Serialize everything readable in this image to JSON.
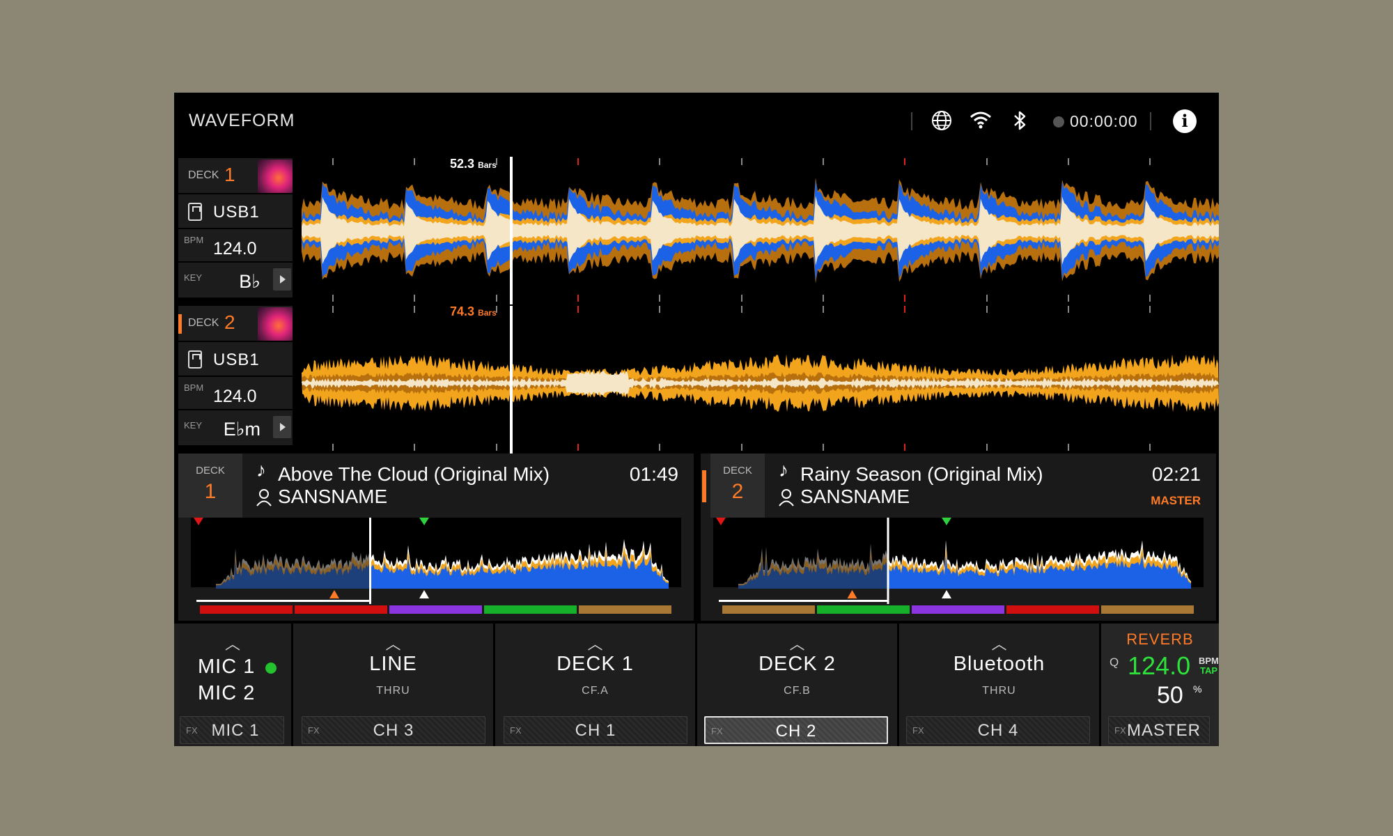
{
  "header": {
    "title": "WAVEFORM",
    "time": "00:00:00",
    "icons": [
      "globe-icon",
      "wifi-icon",
      "bluetooth-icon",
      "rec-indicator-icon",
      "info-icon"
    ]
  },
  "decks": [
    {
      "deck_label": "DECK",
      "deck_num": "1",
      "source": "USB1",
      "bpm_label": "BPM",
      "bpm": "124.0",
      "key_label": "KEY",
      "key": "B♭",
      "bars": "52.3",
      "bars_unit": "Bars"
    },
    {
      "deck_label": "DECK",
      "deck_num": "2",
      "source": "USB1",
      "bpm_label": "BPM",
      "bpm": "124.0",
      "key_label": "KEY",
      "key": "E♭m",
      "bars": "74.3",
      "bars_unit": "Bars"
    }
  ],
  "tracks": [
    {
      "deck_label": "DECK",
      "deck_num": "1",
      "title": "Above The Cloud (Original Mix)",
      "artist": "SANSNAME",
      "time": "01:49",
      "status": ""
    },
    {
      "deck_label": "DECK",
      "deck_num": "2",
      "title": "Rainy Season (Original Mix)",
      "artist": "SANSNAME",
      "time": "02:21",
      "status": "MASTER"
    }
  ],
  "mixer": {
    "mic": {
      "mic1": "MIC 1",
      "mic2": "MIC 2",
      "fx_label": "FX",
      "fx_target": "MIC 1"
    },
    "channels": [
      {
        "name": "LINE",
        "sub": "THRU",
        "fx_label": "FX",
        "fx_target": "CH 3",
        "active": false
      },
      {
        "name": "DECK 1",
        "sub": "CF.A",
        "fx_label": "FX",
        "fx_target": "CH 1",
        "active": false
      },
      {
        "name": "DECK 2",
        "sub": "CF.B",
        "fx_label": "FX",
        "fx_target": "CH 2",
        "active": true
      },
      {
        "name": "Bluetooth",
        "sub": "THRU",
        "fx_label": "FX",
        "fx_target": "CH 4",
        "active": false
      }
    ],
    "effect": {
      "name": "REVERB",
      "q_label": "Q",
      "bpm": "124.0",
      "bpm_unit": "BPM",
      "tap": "TAP",
      "level": "50",
      "level_unit": "%",
      "fx_label": "FX",
      "fx_target": "MASTER"
    }
  },
  "colors": {
    "accent": "#ff7b27",
    "blue": "#1b62e6",
    "amber": "#f2a51c",
    "dark_amber": "#b8700f",
    "cream": "#f4e6c6",
    "green": "#2ee23c"
  },
  "track_progress": [
    0.34,
    0.33
  ],
  "hot_cue_colors": [
    [
      "#d20f0f",
      "#d20f0f",
      "#8a35e0",
      "#17b02a",
      "#a87834"
    ],
    [
      "#a87834",
      "#17b02a",
      "#8a35e0",
      "#d20f0f",
      "#a87834"
    ]
  ]
}
